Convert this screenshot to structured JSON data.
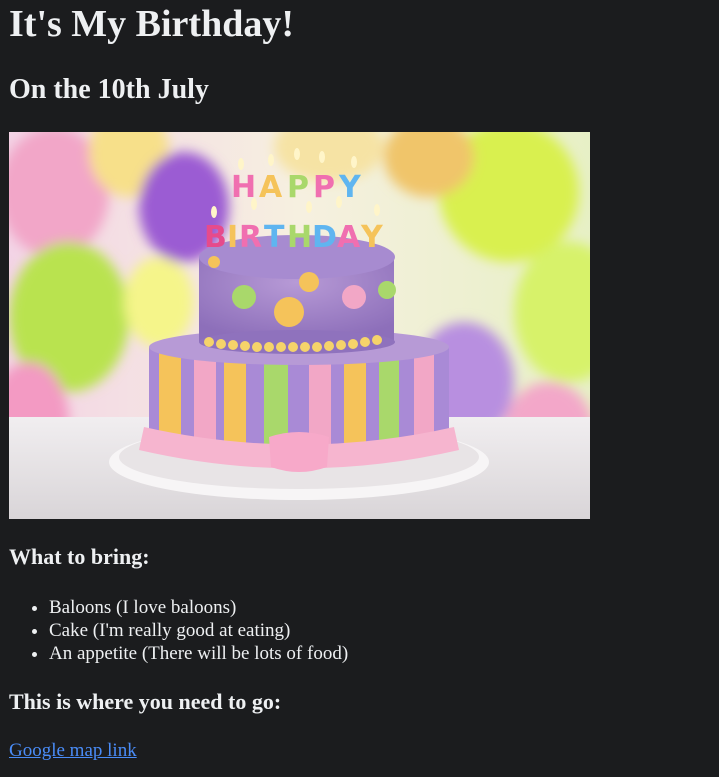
{
  "page": {
    "title": "It's My Birthday!",
    "subtitle": "On the 10th July"
  },
  "image": {
    "alt": "Birthday cake with Happy Birthday candles and balloons",
    "icon": "birthday-cake-image"
  },
  "bring": {
    "heading": "What to bring:",
    "items": [
      "Baloons (I love baloons)",
      "Cake (I'm really good at eating)",
      "An appetite (There will be lots of food)"
    ]
  },
  "directions": {
    "heading": "This is where you need to go:",
    "link_label": "Google map link"
  },
  "colors": {
    "background": "#1b1c1e",
    "text": "#eef0f2",
    "link": "#4a8cf7"
  }
}
